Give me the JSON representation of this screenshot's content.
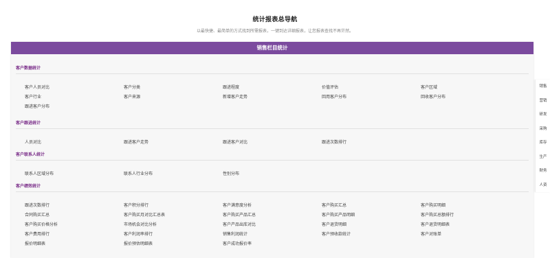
{
  "header": {
    "title": "统计报表总导航",
    "subtitle": "以最快捷、最简单的方式找到所需报表，一键到达详细报表，让您报表查找不再茫然。"
  },
  "panel": {
    "title": "销售栏目统计"
  },
  "sections": [
    {
      "title": "客户数据统计",
      "rows": [
        [
          "客户人员对比",
          "客户分类",
          "跟进程度",
          "价值评估",
          "客户区域"
        ],
        [
          "客户行业",
          "客户来源",
          "新增客户走势",
          "回用客户分布",
          "回收客户分布"
        ],
        [
          "跟进客户分布"
        ]
      ]
    },
    {
      "title": "客户跟进统计",
      "rows": [
        [
          "人员对比",
          "跟进客户走势",
          "跟进客户对比",
          "跟进次数排行"
        ]
      ]
    },
    {
      "title": "客户联系人统计",
      "rows": [
        [
          "联系人区域分布",
          "联系人行业分布",
          "性别分布"
        ]
      ]
    },
    {
      "title": "客户绩效统计",
      "rows": [
        [
          "跟进次数排行",
          "客户积分排行",
          "客户满意度分析",
          "客户购买汇总",
          "客户购买明细"
        ],
        [
          "合同购买汇总",
          "客户购买月对比汇总表",
          "客户购买产品汇总",
          "客户购买产品明细",
          "客户购买总额排行"
        ],
        [
          "客户购买价格分析",
          "市场机会对比分析",
          "客户产品出库对比",
          "客户退货明细",
          "客户退货明细表"
        ],
        [
          "客户费用排行",
          "客户利润率排行",
          "销售利润统计",
          "客户预收款统计",
          "客户对账单"
        ],
        [
          "报价明细表",
          "报价预估明细表",
          "客户成功报价率"
        ]
      ]
    }
  ],
  "right_nav": {
    "items": [
      "销售",
      "营销",
      "研发",
      "采购",
      "库存",
      "生产",
      "财务",
      "人资"
    ]
  },
  "colors": {
    "accent": "#7b4a9e",
    "section_title": "#7b2f8a"
  }
}
